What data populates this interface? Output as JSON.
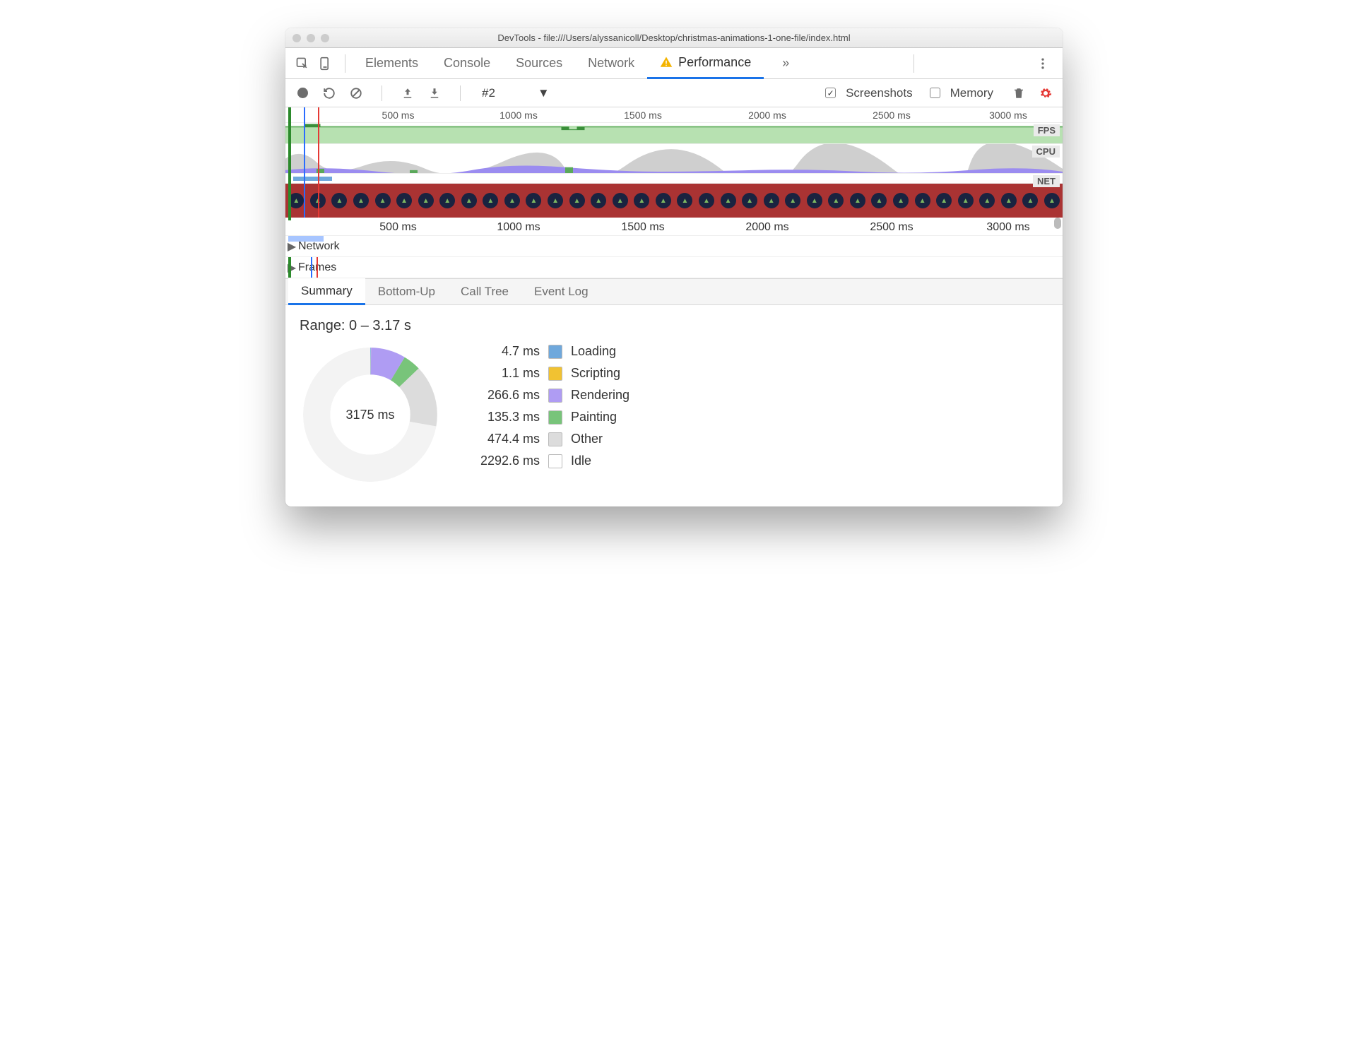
{
  "window": {
    "title": "DevTools - file:///Users/alyssanicoll/Desktop/christmas-animations-1-one-file/index.html"
  },
  "tabs": {
    "elements": "Elements",
    "console": "Console",
    "sources": "Sources",
    "network": "Network",
    "performance": "Performance"
  },
  "toolbar": {
    "profile_selector": "#2",
    "screenshots_label": "Screenshots",
    "memory_label": "Memory",
    "screenshots_checked": true,
    "memory_checked": false
  },
  "overview": {
    "ticks": [
      "500 ms",
      "1000 ms",
      "1500 ms",
      "2000 ms",
      "2500 ms",
      "3000 ms"
    ],
    "lanes": {
      "fps": "FPS",
      "cpu": "CPU",
      "net": "NET"
    }
  },
  "tracks": {
    "network": "Network",
    "frames": "Frames"
  },
  "subtabs": {
    "summary": "Summary",
    "bottomup": "Bottom-Up",
    "calltree": "Call Tree",
    "eventlog": "Event Log"
  },
  "summary": {
    "range_label": "Range: 0 – 3.17 s",
    "total_label": "3175 ms",
    "legend": [
      {
        "ms": "4.7 ms",
        "name": "Loading",
        "color": "#6fa8dc"
      },
      {
        "ms": "1.1 ms",
        "name": "Scripting",
        "color": "#f1c232"
      },
      {
        "ms": "266.6 ms",
        "name": "Rendering",
        "color": "#af9cf3"
      },
      {
        "ms": "135.3 ms",
        "name": "Painting",
        "color": "#78c47a"
      },
      {
        "ms": "474.4 ms",
        "name": "Other",
        "color": "#dcdcdc"
      },
      {
        "ms": "2292.6 ms",
        "name": "Idle",
        "color": "#ffffff"
      }
    ]
  },
  "chart_data": {
    "type": "pie",
    "title": "Time breakdown (3175 ms total)",
    "series": [
      {
        "name": "Loading",
        "value": 4.7,
        "color": "#6fa8dc"
      },
      {
        "name": "Scripting",
        "value": 1.1,
        "color": "#f1c232"
      },
      {
        "name": "Rendering",
        "value": 266.6,
        "color": "#af9cf3"
      },
      {
        "name": "Painting",
        "value": 135.3,
        "color": "#78c47a"
      },
      {
        "name": "Other",
        "value": 474.4,
        "color": "#dcdcdc"
      },
      {
        "name": "Idle",
        "value": 2292.6,
        "color": "#ffffff"
      }
    ],
    "total": 3175
  }
}
